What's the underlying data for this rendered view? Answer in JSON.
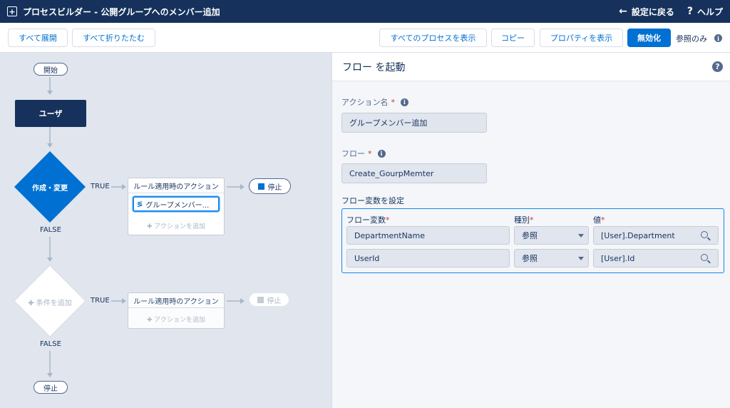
{
  "header": {
    "title": "プロセスビルダー - 公開グループへのメンバー追加",
    "back_label": "設定に戻る",
    "help_label": "ヘルプ"
  },
  "toolbar": {
    "expand_all": "すべて展開",
    "collapse_all": "すべて折りたたむ",
    "show_all_processes": "すべてのプロセスを表示",
    "copy": "コピー",
    "show_properties": "プロパティを表示",
    "deactivate": "無効化",
    "read_only": "参照のみ"
  },
  "canvas": {
    "start": "開始",
    "object_node": "ユーザ",
    "criteria_1": "作成・変更",
    "true_label": "TRUE",
    "false_label": "FALSE",
    "action_group_header": "ルール適用時のアクション",
    "action_item": "グループメンバー...",
    "add_action": "アクションを追加",
    "stop": "停止",
    "add_criteria": "条件を追加",
    "end_stop": "停止"
  },
  "panel": {
    "title": "フロー を起動",
    "action_name_label": "アクション名",
    "action_name_value": "グループメンバー追加",
    "flow_label": "フロー",
    "flow_value": "Create_GourpMemter",
    "set_vars_label": "フロー変数を設定",
    "col_var": "フロー変数",
    "col_type": "種別",
    "col_value": "値",
    "rows": [
      {
        "var": "DepartmentName",
        "type": "参照",
        "value": "[User].Department"
      },
      {
        "var": "UserId",
        "type": "参照",
        "value": "[User].Id"
      }
    ]
  },
  "colors": {
    "navy": "#16325c",
    "brand_blue": "#0070d2",
    "canvas_bg": "#e0e5ee"
  }
}
